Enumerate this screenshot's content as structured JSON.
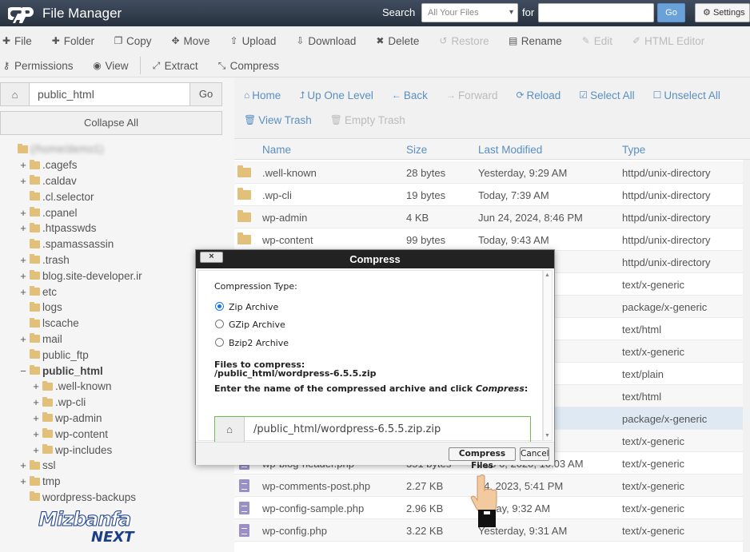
{
  "header": {
    "app_title": "File Manager",
    "search_label": "Search",
    "search_scope": "All Your Files",
    "for_label": "for",
    "search_placeholder": "",
    "go_label": "Go",
    "settings_label": "Settings"
  },
  "toolbar": {
    "row1": [
      {
        "label": "File",
        "icon": "plus-icon",
        "enabled": true
      },
      {
        "label": "Folder",
        "icon": "plus-icon",
        "enabled": true
      },
      {
        "label": "Copy",
        "icon": "copy-icon",
        "enabled": true
      },
      {
        "label": "Move",
        "icon": "move-icon",
        "enabled": true
      },
      {
        "label": "Upload",
        "icon": "upload-icon",
        "enabled": true
      },
      {
        "label": "Download",
        "icon": "download-icon",
        "enabled": true
      },
      {
        "label": "Delete",
        "icon": "times-icon",
        "enabled": true
      },
      {
        "label": "Restore",
        "icon": "undo-icon",
        "enabled": false
      },
      {
        "label": "Rename",
        "icon": "file-icon",
        "enabled": true
      },
      {
        "label": "Edit",
        "icon": "pencil-icon",
        "enabled": false
      },
      {
        "label": "HTML Editor",
        "icon": "html-edit-icon",
        "enabled": false
      }
    ],
    "row2": [
      {
        "label": "Permissions",
        "icon": "key-icon",
        "enabled": true
      },
      {
        "label": "View",
        "icon": "eye-icon",
        "enabled": true
      },
      {
        "label": "Extract",
        "icon": "expand-icon",
        "enabled": true
      },
      {
        "label": "Compress",
        "icon": "compress-icon",
        "enabled": true
      }
    ]
  },
  "left": {
    "path_value": "public_html",
    "go_label": "Go",
    "collapse_label": "Collapse All",
    "tree": [
      {
        "label": "(/home/demo1)",
        "indent": 0,
        "toggle": "",
        "blurred": true,
        "active": false
      },
      {
        "label": ".cagefs",
        "indent": 1,
        "toggle": "+",
        "active": false
      },
      {
        "label": ".caldav",
        "indent": 1,
        "toggle": "+",
        "active": false
      },
      {
        "label": ".cl.selector",
        "indent": 1,
        "toggle": "",
        "active": false
      },
      {
        "label": ".cpanel",
        "indent": 1,
        "toggle": "+",
        "active": false
      },
      {
        "label": ".htpasswds",
        "indent": 1,
        "toggle": "+",
        "active": false
      },
      {
        "label": ".spamassassin",
        "indent": 1,
        "toggle": "",
        "active": false
      },
      {
        "label": ".trash",
        "indent": 1,
        "toggle": "+",
        "active": false
      },
      {
        "label": "blog.site-developer.ir",
        "indent": 1,
        "toggle": "+",
        "active": false
      },
      {
        "label": "etc",
        "indent": 1,
        "toggle": "+",
        "active": false
      },
      {
        "label": "logs",
        "indent": 1,
        "toggle": "",
        "active": false
      },
      {
        "label": "lscache",
        "indent": 1,
        "toggle": "",
        "active": false
      },
      {
        "label": "mail",
        "indent": 1,
        "toggle": "+",
        "active": false
      },
      {
        "label": "public_ftp",
        "indent": 1,
        "toggle": "",
        "active": false
      },
      {
        "label": "public_html",
        "indent": 1,
        "toggle": "−",
        "active": true
      },
      {
        "label": ".well-known",
        "indent": 2,
        "toggle": "+",
        "active": false
      },
      {
        "label": ".wp-cli",
        "indent": 2,
        "toggle": "+",
        "active": false
      },
      {
        "label": "wp-admin",
        "indent": 2,
        "toggle": "+",
        "active": false
      },
      {
        "label": "wp-content",
        "indent": 2,
        "toggle": "+",
        "active": false
      },
      {
        "label": "wp-includes",
        "indent": 2,
        "toggle": "+",
        "active": false
      },
      {
        "label": "ssl",
        "indent": 1,
        "toggle": "+",
        "active": false
      },
      {
        "label": "tmp",
        "indent": 1,
        "toggle": "+",
        "active": false
      },
      {
        "label": "wordpress-backups",
        "indent": 1,
        "toggle": "",
        "active": false
      }
    ]
  },
  "nav": {
    "row1": [
      {
        "label": "Home",
        "icon": "home-icon",
        "enabled": true
      },
      {
        "label": "Up One Level",
        "icon": "level-up-icon",
        "enabled": true
      },
      {
        "label": "Back",
        "icon": "arrow-left-icon",
        "enabled": true
      },
      {
        "label": "Forward",
        "icon": "arrow-right-icon",
        "enabled": false
      },
      {
        "label": "Reload",
        "icon": "reload-icon",
        "enabled": true
      },
      {
        "label": "Select All",
        "icon": "checkbox-checked-icon",
        "enabled": true
      },
      {
        "label": "Unselect All",
        "icon": "checkbox-empty-icon",
        "enabled": true
      }
    ],
    "row2": [
      {
        "label": "View Trash",
        "icon": "trash-icon",
        "enabled": true
      },
      {
        "label": "Empty Trash",
        "icon": "trash-icon",
        "enabled": false
      }
    ]
  },
  "table": {
    "headers": [
      "Name",
      "Size",
      "Last Modified",
      "Type"
    ],
    "rows": [
      {
        "icon": "dir",
        "name": ".well-known",
        "size": "28 bytes",
        "modified": "Yesterday, 9:29 AM",
        "type": "httpd/unix-directory",
        "selected": false
      },
      {
        "icon": "dir",
        "name": ".wp-cli",
        "size": "19 bytes",
        "modified": "Today, 7:39 AM",
        "type": "httpd/unix-directory",
        "selected": false
      },
      {
        "icon": "dir",
        "name": "wp-admin",
        "size": "4 KB",
        "modified": "Jun 24, 2024, 8:46 PM",
        "type": "httpd/unix-directory",
        "selected": false
      },
      {
        "icon": "dir",
        "name": "wp-content",
        "size": "99 bytes",
        "modified": "Today, 9:43 AM",
        "type": "httpd/unix-directory",
        "selected": false
      },
      {
        "icon": "dir",
        "name": "",
        "size": "",
        "modified": "AM",
        "type": "httpd/unix-directory",
        "selected": false
      },
      {
        "icon": "",
        "name": "",
        "size": "",
        "modified": "AM",
        "type": "text/x-generic",
        "selected": false
      },
      {
        "icon": "",
        "name": "",
        "size": "",
        "modified": "",
        "type": "package/x-generic",
        "selected": false
      },
      {
        "icon": "",
        "name": "",
        "size": "",
        "modified": "4 AM",
        "type": "text/html",
        "selected": false
      },
      {
        "icon": "",
        "name": "",
        "size": "",
        "modified": "03 AM",
        "type": "text/x-generic",
        "selected": false
      },
      {
        "icon": "",
        "name": "",
        "size": "",
        "modified": "AM",
        "type": "text/plain",
        "selected": false
      },
      {
        "icon": "",
        "name": "",
        "size": "",
        "modified": "AM",
        "type": "text/html",
        "selected": false
      },
      {
        "icon": "",
        "name": "",
        "size": "",
        "modified": "AM",
        "type": "package/x-generic",
        "selected": true
      },
      {
        "icon": "",
        "name": "",
        "size": "",
        "modified": "49 PM",
        "type": "text/x-generic",
        "selected": false
      },
      {
        "icon": "doc",
        "name": "wp-blog-header.php",
        "size": "351 bytes",
        "modified": "Feb 6, 2020, 10:03 AM",
        "type": "text/x-generic",
        "selected": false
      },
      {
        "icon": "doc",
        "name": "wp-comments-post.php",
        "size": "2.27 KB",
        "modified": "14, 2023, 5:41 PM",
        "type": "text/x-generic",
        "selected": false
      },
      {
        "icon": "doc",
        "name": "wp-config-sample.php",
        "size": "2.96 KB",
        "modified": "terday, 9:32 AM",
        "type": "text/x-generic",
        "selected": false
      },
      {
        "icon": "doc",
        "name": "wp-config.php",
        "size": "3.22 KB",
        "modified": "Yesterday, 9:31 AM",
        "type": "text/x-generic",
        "selected": false
      }
    ]
  },
  "modal": {
    "title": "Compress",
    "close_label": "×",
    "compression_type_label": "Compression Type:",
    "options": [
      {
        "label": "Zip Archive",
        "checked": true
      },
      {
        "label": "GZip Archive",
        "checked": false
      },
      {
        "label": "Bzip2 Archive",
        "checked": false
      }
    ],
    "files_label": "Files to compress:",
    "files_value": "/public_html/wordpress-6.5.5.zip",
    "instruction_prefix": "Enter the name of the compressed archive and click ",
    "instruction_emph": "Compress",
    "instruction_suffix": ":",
    "archive_name": "/public_html/wordpress-6.5.5.zip.zip",
    "compress_button": "Compress Files",
    "cancel_button": "Cancel"
  },
  "watermark": {
    "line1": "Mizbanfa",
    "line2": "NEXT"
  },
  "colors": {
    "header_bg": "#2d3a4e",
    "link": "#5a8fc3",
    "folder": "#e2c07a",
    "selected_row": "#dfe9f3",
    "radio_checked": "#1a73e8",
    "input_focus": "#6bbf4a"
  }
}
